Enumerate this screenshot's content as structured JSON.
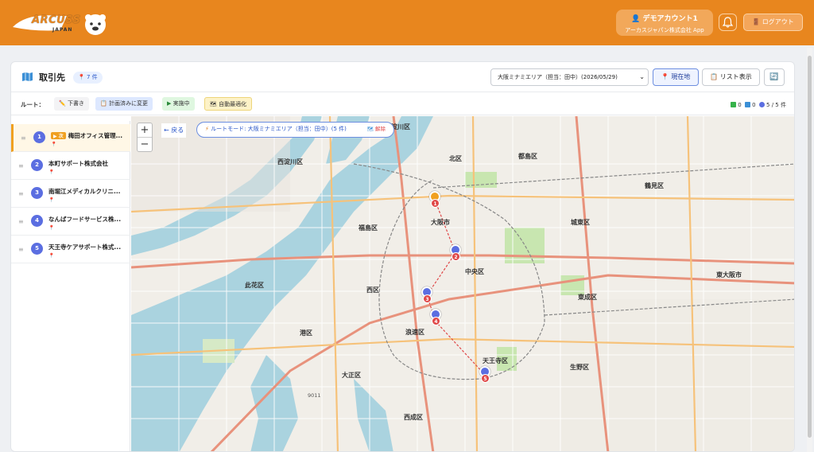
{
  "header": {
    "logo_text": "ARCUSS",
    "logo_sub": "JAPAN",
    "account_name": "デモアカウント1",
    "account_org": "アーカスジャパン株式会社 App",
    "logout_label": "ログアウト",
    "brand_color": "#e8861e"
  },
  "titlebar": {
    "title": "取引先",
    "count": "7 件",
    "area_select": "大阪ミナミエリア（担当：田中）(2026/05/29)",
    "current_location": "現在地",
    "list_view": "リスト表示"
  },
  "routebar": {
    "label": "ルート：",
    "chips": {
      "draft": "下書き",
      "planned": "計画済みに変更",
      "in_progress": "実施中",
      "auto_optimize": "自動最適化"
    },
    "stats": {
      "done": "0",
      "pending": "0",
      "progress": "5 / 5 件"
    }
  },
  "list": {
    "next_tag": "次",
    "items": [
      {
        "num": "1",
        "name": "梅田オフィス管理..."
      },
      {
        "num": "2",
        "name": "本町サポート株式会社"
      },
      {
        "num": "3",
        "name": "南堀江メディカルクリニ..."
      },
      {
        "num": "4",
        "name": "なんばフードサービス株..."
      },
      {
        "num": "5",
        "name": "天王寺ケアサポート株式..."
      }
    ]
  },
  "map": {
    "zoom_in": "+",
    "zoom_out": "−",
    "back": "← 戻る",
    "route_mode": "ルートモード: 大阪ミナミエリア（担当：田中）(5 件)",
    "edit": "解除",
    "markers": [
      "1",
      "2",
      "3",
      "4",
      "5"
    ],
    "labels": {
      "kita": "北区",
      "osaka_station": "大阪市",
      "fukushima": "福島区",
      "chuo": "中央区",
      "nishi": "西区",
      "minato": "港区",
      "naniwa": "浪速区",
      "tennoji": "天王寺区",
      "taisho": "大正区",
      "nishinari": "西成区",
      "joto": "城東区",
      "higashinari": "東成区",
      "ikuno": "生野区",
      "higashiosaka": "東大阪市",
      "tsurumi": "鶴見区",
      "konohana": "此花区",
      "miyakojima": "都島区",
      "nishiyodogawa": "西淀川区",
      "yodogawa": "淀川区",
      "sumiyoshi": "住之江区",
      "suita_jct": "9011"
    }
  }
}
